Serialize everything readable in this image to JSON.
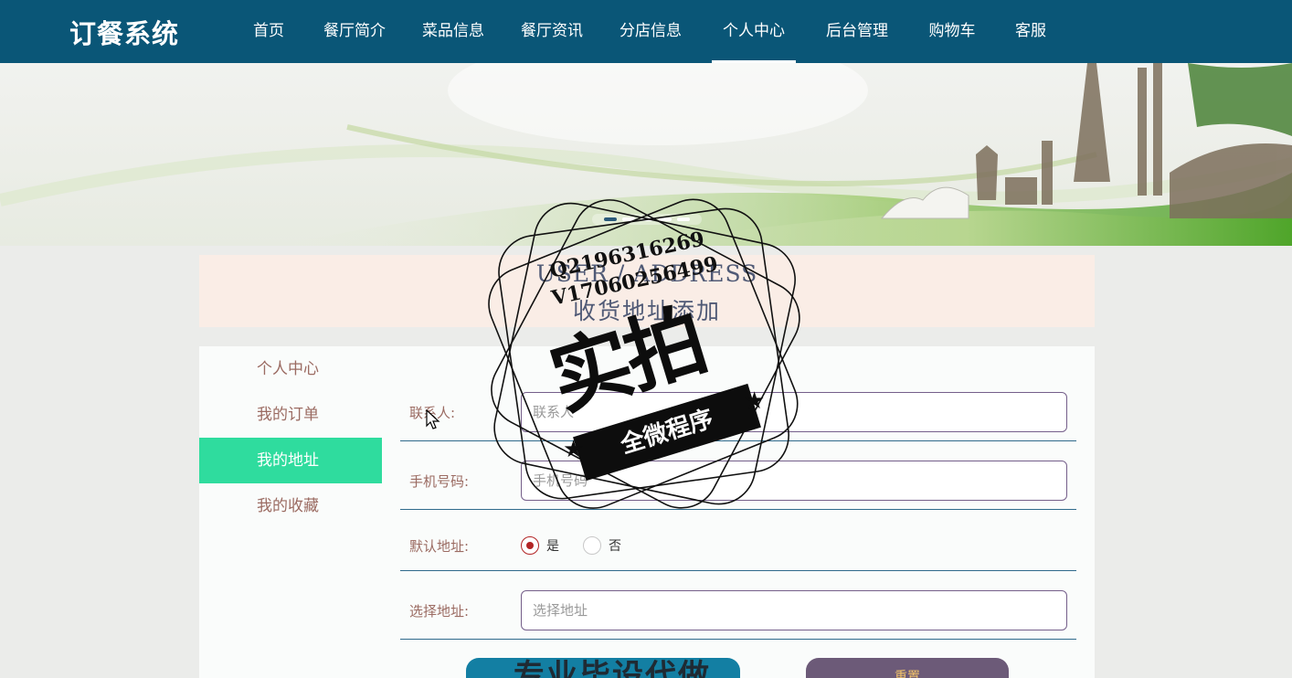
{
  "header": {
    "brand": "订餐系统",
    "nav": [
      {
        "label": "首页",
        "active": false
      },
      {
        "label": "餐厅简介",
        "active": false
      },
      {
        "label": "菜品信息",
        "active": false
      },
      {
        "label": "餐厅资讯",
        "active": false
      },
      {
        "label": "分店信息",
        "active": false
      },
      {
        "label": "个人中心",
        "active": true
      },
      {
        "label": "后台管理",
        "active": false
      },
      {
        "label": "购物车",
        "active": false
      },
      {
        "label": "客服",
        "active": false
      }
    ]
  },
  "banner": {
    "slides": 5,
    "active_slide": 1
  },
  "page_title": {
    "en": "USER / ADDRESS",
    "cn": "收货地址添加"
  },
  "sidebar": {
    "items": [
      {
        "label": "个人中心",
        "active": false
      },
      {
        "label": "我的订单",
        "active": false
      },
      {
        "label": "我的地址",
        "active": true
      },
      {
        "label": "我的收藏",
        "active": false
      }
    ]
  },
  "form": {
    "contact": {
      "label": "联系人:",
      "placeholder": "联系人",
      "value": ""
    },
    "phone": {
      "label": "手机号码:",
      "placeholder": "手机号码",
      "value": ""
    },
    "default_address": {
      "label": "默认地址:",
      "options": [
        {
          "label": "是",
          "checked": true
        },
        {
          "label": "否",
          "checked": false
        }
      ]
    },
    "address": {
      "label": "选择地址:",
      "placeholder": "选择地址",
      "value": ""
    },
    "reset_label": "重置"
  },
  "watermark": {
    "line1": "Q2196316269",
    "line2": "V17060256499",
    "big": "实拍",
    "ribbon": "全微程序",
    "promo": "专业毕设代做"
  },
  "colors": {
    "nav_bg": "#0a5677",
    "sidebar_active": "#2fdc9e",
    "title_bg": "#faede6",
    "label_text": "#9b6b62",
    "radio_checked": "#b22424",
    "reset_button": "#6c5a78",
    "submit_button": "#137fa3"
  }
}
